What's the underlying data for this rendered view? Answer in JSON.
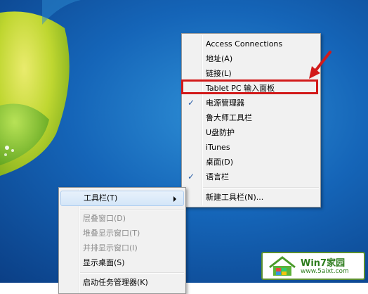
{
  "context_menu": {
    "items": [
      {
        "label": "工具栏(T)",
        "state": "highlighted",
        "has_submenu": true
      },
      {
        "label": "层叠窗口(D)",
        "state": "disabled"
      },
      {
        "label": "堆叠显示窗口(T)",
        "state": "disabled"
      },
      {
        "label": "并排显示窗口(I)",
        "state": "disabled"
      },
      {
        "label": "显示桌面(S)",
        "state": "enabled"
      },
      {
        "label": "启动任务管理器(K)",
        "state": "enabled"
      }
    ]
  },
  "toolbars_submenu": {
    "items": [
      {
        "label": "Access Connections",
        "checked": false
      },
      {
        "label": "地址(A)",
        "checked": false
      },
      {
        "label": "链接(L)",
        "checked": false
      },
      {
        "label": "Tablet PC 输入面板",
        "checked": false,
        "emphasized": true
      },
      {
        "label": "电源管理器",
        "checked": true
      },
      {
        "label": "鲁大师工具栏",
        "checked": false
      },
      {
        "label": "U盘防护",
        "checked": false
      },
      {
        "label": "iTunes",
        "checked": false
      },
      {
        "label": "桌面(D)",
        "checked": false
      },
      {
        "label": "语言栏",
        "checked": true
      }
    ],
    "new_toolbar_label": "新建工具栏(N)..."
  },
  "watermark": {
    "brand": "Win7家园",
    "url": "www.5aixt.com"
  },
  "colors": {
    "highlight_border": "#d21a1a",
    "menu_bg": "#f1f1f1",
    "desktop_blue": "#1565b8",
    "watermark_green": "#2e7d1e"
  }
}
